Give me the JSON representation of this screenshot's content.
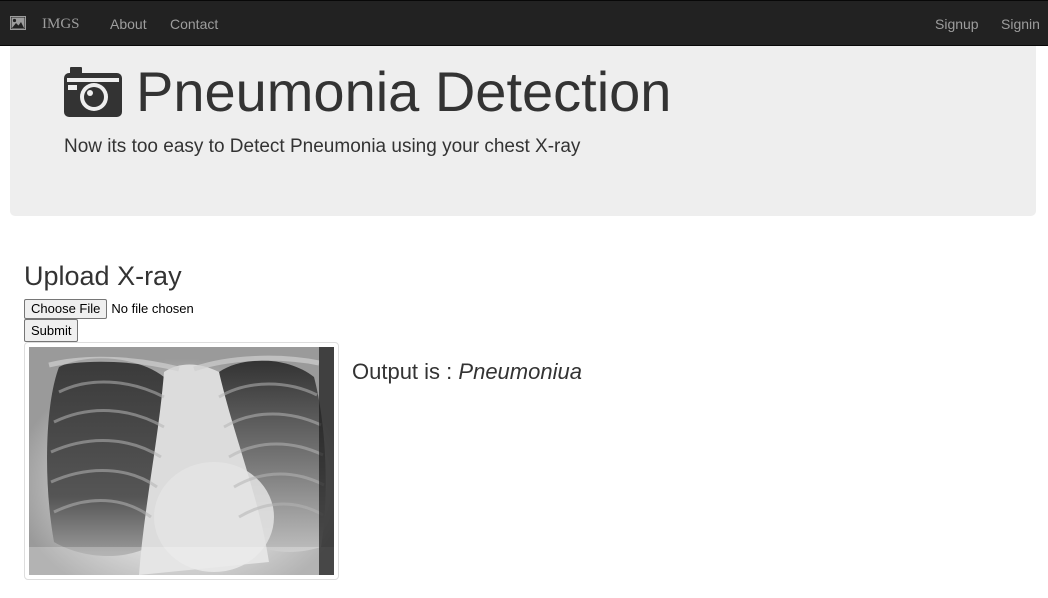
{
  "navbar": {
    "brand_icon": "image-icon",
    "brand": "IMGS",
    "links": {
      "about": "About",
      "contact": "Contact",
      "signup": "Signup",
      "signin": "Signin"
    },
    "colors": {
      "background": "#222222",
      "link": "#9d9d9d"
    }
  },
  "jumbotron": {
    "icon": "camera-icon",
    "title": "Pneumonia Detection",
    "subtitle": "Now its too easy to Detect Pneumonia using your chest X-ray",
    "background": "#eeeeee"
  },
  "upload": {
    "heading": "Upload X-ray",
    "choose_file_label": "Choose File",
    "file_status": "No file chosen",
    "submit_label": "Submit"
  },
  "result": {
    "image": "chest-xray-image",
    "output_label": "Output is :",
    "output_value": "Pneumoniua"
  }
}
